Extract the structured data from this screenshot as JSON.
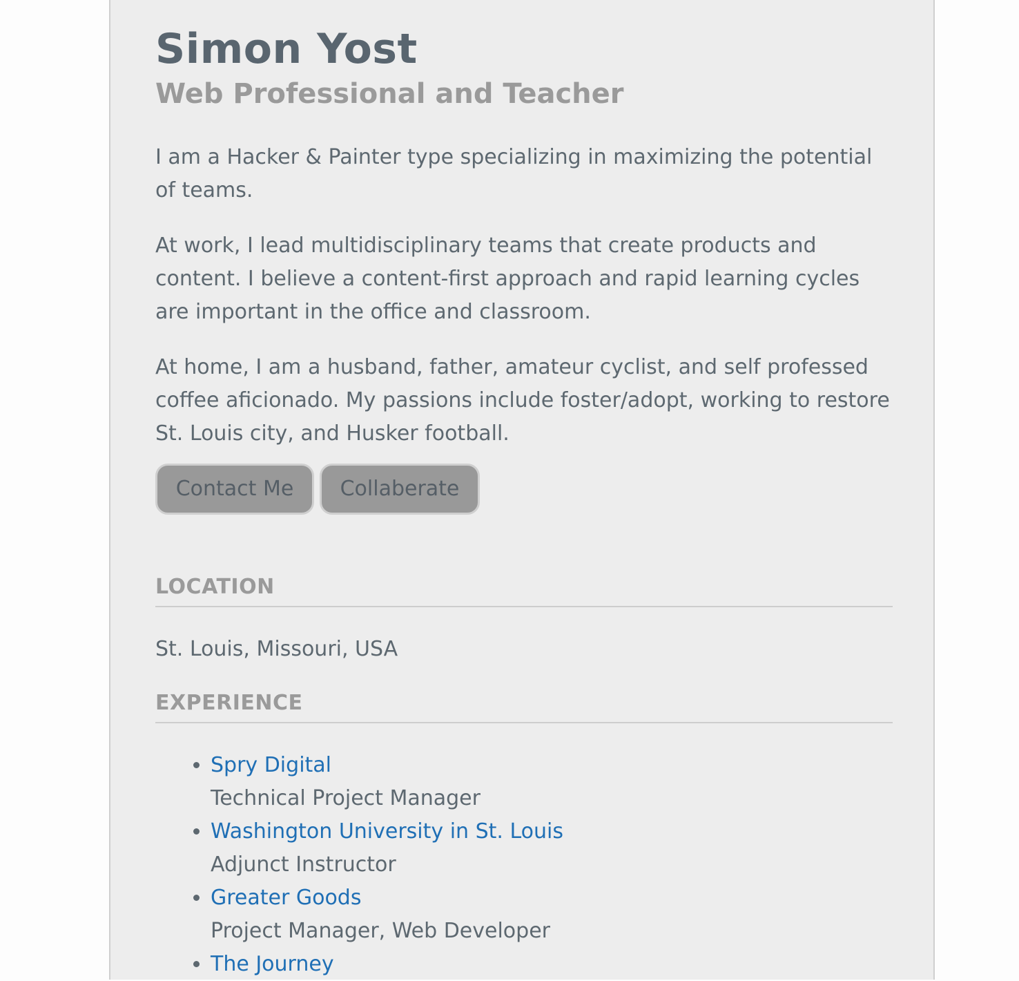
{
  "profile": {
    "name": "Simon Yost",
    "subtitle": "Web Professional and Teacher"
  },
  "bio": {
    "p1": "I am a Hacker & Painter type specializing in maximizing the potential of teams.",
    "p2": "At work, I lead multidisciplinary teams that create products and content. I believe a content-first approach and rapid learning cycles are important in the office and classroom.",
    "p3": "At home, I am a husband, father, amateur cyclist, and self professed coffee aficionado. My passions include foster/adopt, working to restore St. Louis city, and Husker football."
  },
  "buttons": {
    "contact_label": "Contact Me",
    "collab_label": "Collaberate"
  },
  "location": {
    "heading": "LOCATION",
    "value": "St. Louis, Missouri, USA"
  },
  "experience": {
    "heading": "EXPERIENCE",
    "items": [
      {
        "company": "Spry Digital",
        "role": "Technical Project Manager"
      },
      {
        "company": "Washington University in St. Louis",
        "role": "Adjunct Instructor"
      },
      {
        "company": "Greater Goods",
        "role": "Project Manager, Web Developer"
      },
      {
        "company": "The Journey",
        "role": ""
      }
    ]
  },
  "colors": {
    "card_background": "#ededed",
    "link": "#1f6fb5",
    "heading_muted": "#9a9a9a",
    "button": "#999999"
  }
}
